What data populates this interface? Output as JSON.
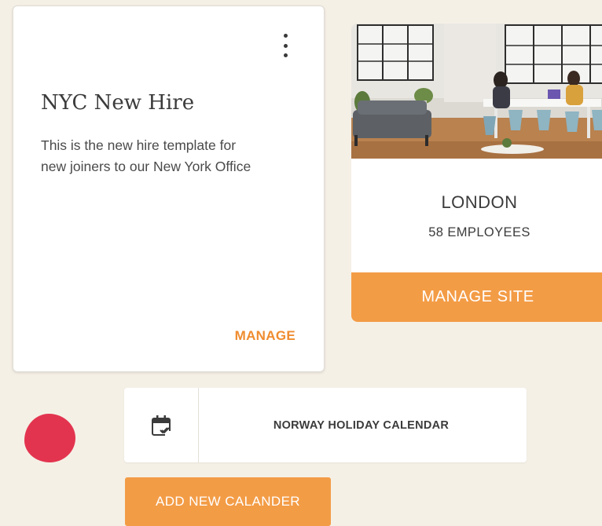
{
  "template_card": {
    "title": "NYC New Hire",
    "description": "This is the new hire template for new joiners to our New York Office",
    "manage_label": "MANAGE",
    "menu_icon": "more-vertical-icon"
  },
  "site_card": {
    "name": "LONDON",
    "employees": "58 EMPLOYEES",
    "manage_label": "MANAGE SITE",
    "photo": "office-interior-photo"
  },
  "calendar": {
    "icon": "calendar-check-icon",
    "label": "NORWAY HOLIDAY CALENDAR"
  },
  "add_calendar": {
    "label": "ADD NEW CALANDER"
  },
  "colors": {
    "background": "#f5f0e6",
    "accent": "#f39c46",
    "link": "#ef8c2f",
    "blob": "#e3344f",
    "text": "#3b3b3b"
  }
}
